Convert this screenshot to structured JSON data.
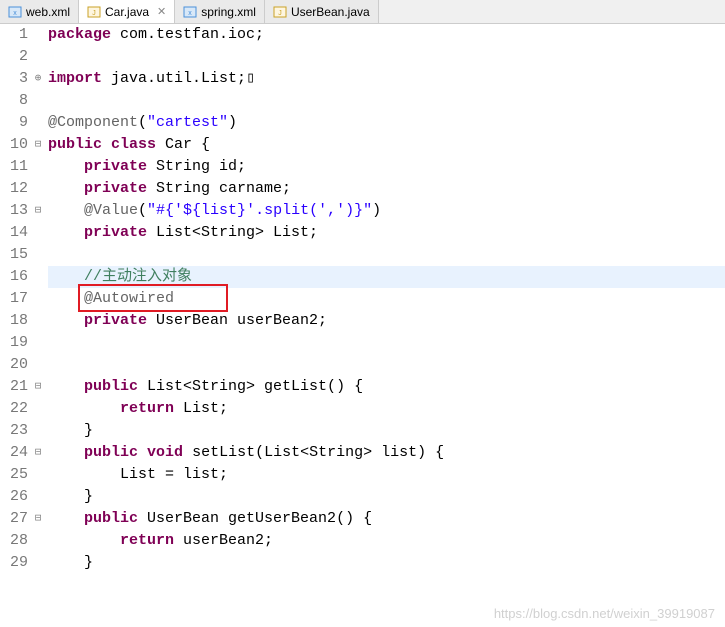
{
  "tabs": [
    {
      "label": "web.xml",
      "icon": "xml-icon",
      "active": false
    },
    {
      "label": "Car.java",
      "icon": "java-icon",
      "active": true
    },
    {
      "label": "spring.xml",
      "icon": "xml-icon",
      "active": false
    },
    {
      "label": "UserBean.java",
      "icon": "java-icon",
      "active": false
    }
  ],
  "gutter": [
    "1",
    "2",
    "3",
    "8",
    "9",
    "10",
    "11",
    "12",
    "13",
    "14",
    "15",
    "16",
    "17",
    "18",
    "19",
    "20",
    "21",
    "22",
    "23",
    "24",
    "25",
    "26",
    "27",
    "28",
    "29"
  ],
  "fold": {
    "l1": "",
    "l2": "",
    "l3": "⊕",
    "l8": "",
    "l9": "",
    "l10": "⊟",
    "l11": "",
    "l12": "",
    "l13": "⊟",
    "l14": "",
    "l15": "",
    "l16": "",
    "l17": "",
    "l18": "",
    "l19": "",
    "l20": "",
    "l21": "⊟",
    "l22": "",
    "l23": "",
    "l24": "⊟",
    "l25": "",
    "l26": "",
    "l27": "⊟",
    "l28": "",
    "l29": ""
  },
  "code": {
    "l1_kw": "package",
    "l1_txt": " com.testfan.ioc;",
    "l3_kw": "import",
    "l3_txt": " java.util.List;",
    "l9_ann": "@Component",
    "l9_paren": "(",
    "l9_str": "\"cartest\"",
    "l9_close": ")",
    "l10_kw1": "public",
    "l10_kw2": "class",
    "l10_name": " Car {",
    "l11_kw": "private",
    "l11_type": " String id;",
    "l12_kw": "private",
    "l12_type": " String carname;",
    "l13_ann": "@Value",
    "l13_paren": "(",
    "l13_str": "\"#{'${list}'.split(',')}\"",
    "l13_close": ")",
    "l14_kw": "private",
    "l14_type": " List<String> List;",
    "l16_comment": "//主动注入对象",
    "l17_ann": "@Autowired",
    "l18_kw": "private",
    "l18_type": " UserBean userBean2;",
    "l21_kw": "public",
    "l21_sig": " List<String> getList() {",
    "l22_kw": "return",
    "l22_txt": " List;",
    "l23_txt": "}",
    "l24_kw1": "public",
    "l24_kw2": "void",
    "l24_sig": " setList(List<String> list) {",
    "l25_txt": "List = list;",
    "l26_txt": "}",
    "l27_kw": "public",
    "l27_sig": " UserBean getUserBean2() {",
    "l28_kw": "return",
    "l28_txt": " userBean2;",
    "l29_txt": "}"
  },
  "watermark": "https://blog.csdn.net/weixin_39919087"
}
